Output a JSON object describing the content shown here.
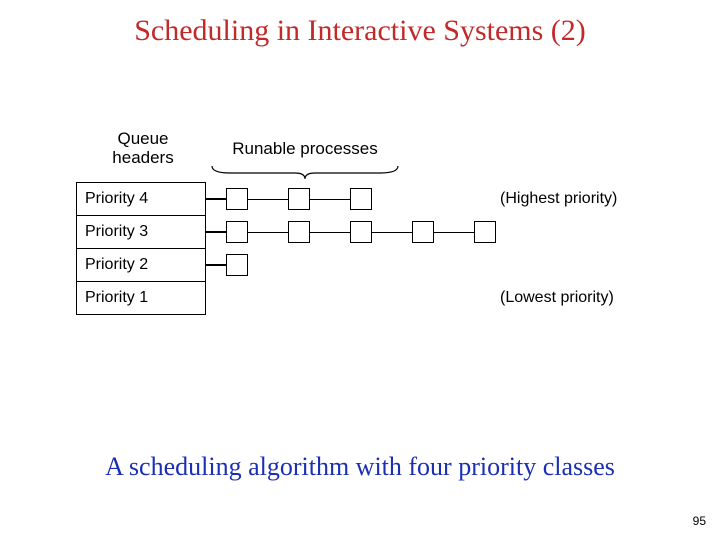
{
  "title": "Scheduling in Interactive Systems (2)",
  "diagram": {
    "queue_headers_label": "Queue\nheaders",
    "runable_label": "Runable processes",
    "priorities": {
      "p4": "Priority 4",
      "p3": "Priority 3",
      "p2": "Priority 2",
      "p1": "Priority 1"
    },
    "highest": "(Highest priority)",
    "lowest": "(Lowest priority)",
    "process_counts": {
      "p4": 3,
      "p3": 5,
      "p2": 1,
      "p1": 0
    }
  },
  "caption": "A scheduling algorithm with four priority classes",
  "page_number": "95"
}
